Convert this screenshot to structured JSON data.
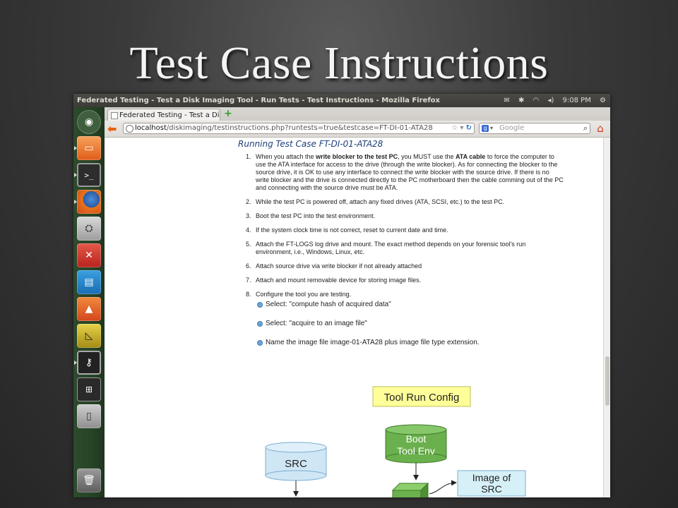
{
  "slide": {
    "title": "Test Case Instructions"
  },
  "top_panel": {
    "window_title": "Federated Testing - Test a Disk Imaging Tool - Run Tests - Test Instructions - Mozilla Firefox",
    "time": "9:08 PM"
  },
  "launcher": {
    "items": [
      "dash-home",
      "files",
      "terminal",
      "firefox",
      "disk-utility",
      "system-settings",
      "libreoffice-writer",
      "software-center",
      "geometry-app",
      "secure-device",
      "workspace-switcher",
      "usb-drive",
      "trash"
    ]
  },
  "browser": {
    "tab_title": "Federated Testing - Test a Disk...",
    "new_tab": "+",
    "url_host": "localhost",
    "url_path": "/diskimaging/testinstructions.php?runtests=true&testcase=FT-DI-01-ATA28",
    "search_placeholder": "Google"
  },
  "page": {
    "heading": "Running Test Case FT-DI-01-ATA28",
    "steps": [
      {
        "num": "1.",
        "parts": [
          {
            "t": "When you attach the ",
            "b": false
          },
          {
            "t": "write blocker to the test PC",
            "b": true
          },
          {
            "t": ", you MUST use the ",
            "b": false
          },
          {
            "t": "ATA cable",
            "b": true
          },
          {
            "t": " to force the computer to use the ATA interface for access to the drive (through the write blocker). As for connecting the blocker to the source drive, it is OK to use any interface to connect the write blocker with the source drive. If there is no write blocker and the drive is connected directly to the PC motherboard then the cable comming out of the PC and connecting with the source drive must be ATA.",
            "b": false
          }
        ]
      },
      {
        "num": "2.",
        "parts": [
          {
            "t": "While the test PC is powered off, attach any fixed drives (ATA, SCSI, etc.) to the test PC.",
            "b": false
          }
        ]
      },
      {
        "num": "3.",
        "parts": [
          {
            "t": "Boot the test PC into the test environment.",
            "b": false
          }
        ]
      },
      {
        "num": "4.",
        "parts": [
          {
            "t": "If the system clock time is not correct, reset to current date and time.",
            "b": false
          }
        ]
      },
      {
        "num": "5.",
        "parts": [
          {
            "t": "Attach the FT-LOGS log drive and mount. The exact method depends on your forensic tool's run environment, i.e., Windows, Linux, etc.",
            "b": false
          }
        ]
      },
      {
        "num": "6.",
        "parts": [
          {
            "t": "Attach source drive via write blocker if not already attached",
            "b": false
          }
        ]
      },
      {
        "num": "7.",
        "parts": [
          {
            "t": "Attach and mount removable device for storing image files.",
            "b": false
          }
        ]
      },
      {
        "num": "8.",
        "parts": [
          {
            "t": "Configure the tool you are testing.",
            "b": false
          }
        ]
      }
    ],
    "sub_steps": [
      "Select: \"compute hash of acquired data\"",
      "Select: \"acquire to an image file\"",
      "Name the image file image-01-ATA28 plus image file type extension."
    ]
  },
  "diagram": {
    "config_label": "Tool Run Config",
    "boot_label_1": "Boot",
    "boot_label_2": "Tool Env",
    "src_label": "SRC",
    "image_label_1": "Image of",
    "image_label_2": "SRC"
  },
  "colors": {
    "launcher_bg": "#274427",
    "heading": "#1f3f7a",
    "config_fill": "#ffff99",
    "boot_fill": "#6ab04c",
    "src_fill": "#cfe6f5",
    "image_fill": "#d6f0f7"
  }
}
